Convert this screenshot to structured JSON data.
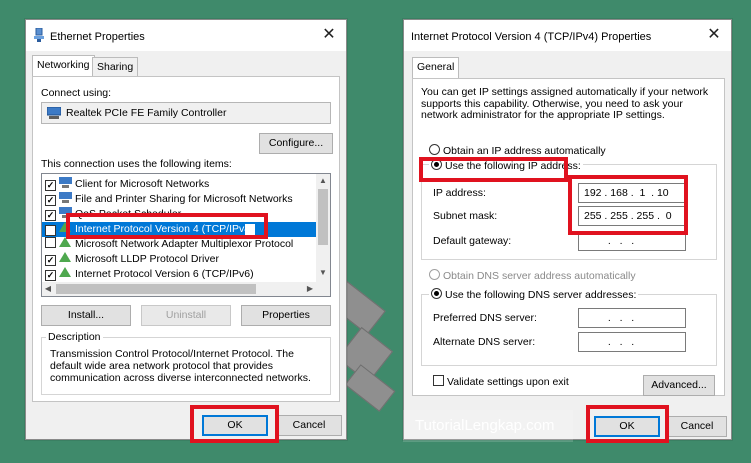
{
  "left_dialog": {
    "title": "Ethernet Properties",
    "tabs": [
      "Networking",
      "Sharing"
    ],
    "connect_using_label": "Connect using:",
    "adapter_name": "Realtek PCIe FE Family Controller",
    "configure_label": "Configure...",
    "items_label": "This connection uses the following items:",
    "items": [
      {
        "label": "Client for Microsoft Networks",
        "checked": true
      },
      {
        "label": "File and Printer Sharing for Microsoft Networks",
        "checked": true
      },
      {
        "label": "QoS Packet Scheduler",
        "checked": true
      },
      {
        "label": "Internet Protocol Version 4 (TCP/IPv4)",
        "checked": true,
        "selected": true
      },
      {
        "label": "Microsoft Network Adapter Multiplexor Protocol",
        "checked": false
      },
      {
        "label": "Microsoft LLDP Protocol Driver",
        "checked": true
      },
      {
        "label": "Internet Protocol Version 6 (TCP/IPv6)",
        "checked": true
      }
    ],
    "install_label": "Install...",
    "uninstall_label": "Uninstall",
    "properties_label": "Properties",
    "description_title": "Description",
    "description_text": "Transmission Control Protocol/Internet Protocol. The default wide area network protocol that provides communication across diverse interconnected networks.",
    "ok_label": "OK",
    "cancel_label": "Cancel"
  },
  "right_dialog": {
    "title": "Internet Protocol Version 4 (TCP/IPv4) Properties",
    "tab": "General",
    "intro_text": "You can get IP settings assigned automatically if your network supports this capability. Otherwise, you need to ask your network administrator for the appropriate IP settings.",
    "obtain_ip_auto": "Obtain an IP address automatically",
    "use_following_ip": "Use the following IP address:",
    "ip_address_label": "IP address:",
    "ip_address_value": "192 . 168 .  1  . 10",
    "subnet_label": "Subnet mask:",
    "subnet_value": "255 . 255 . 255 .  0",
    "gateway_label": "Default gateway:",
    "gateway_value": " .   .   . ",
    "obtain_dns_auto": "Obtain DNS server address automatically",
    "use_following_dns": "Use the following DNS server addresses:",
    "preferred_dns_label": "Preferred DNS server:",
    "preferred_dns_value": " .   .   . ",
    "alternate_dns_label": "Alternate DNS server:",
    "alternate_dns_value": " .   .   . ",
    "validate_label": "Validate settings upon exit",
    "advanced_label": "Advanced...",
    "ok_label": "OK",
    "cancel_label": "Cancel"
  },
  "watermark": "TutorialLengkap.com",
  "colors": {
    "highlight": "#e0121f",
    "selection": "#0078d7",
    "background": "#3f8a6b"
  }
}
